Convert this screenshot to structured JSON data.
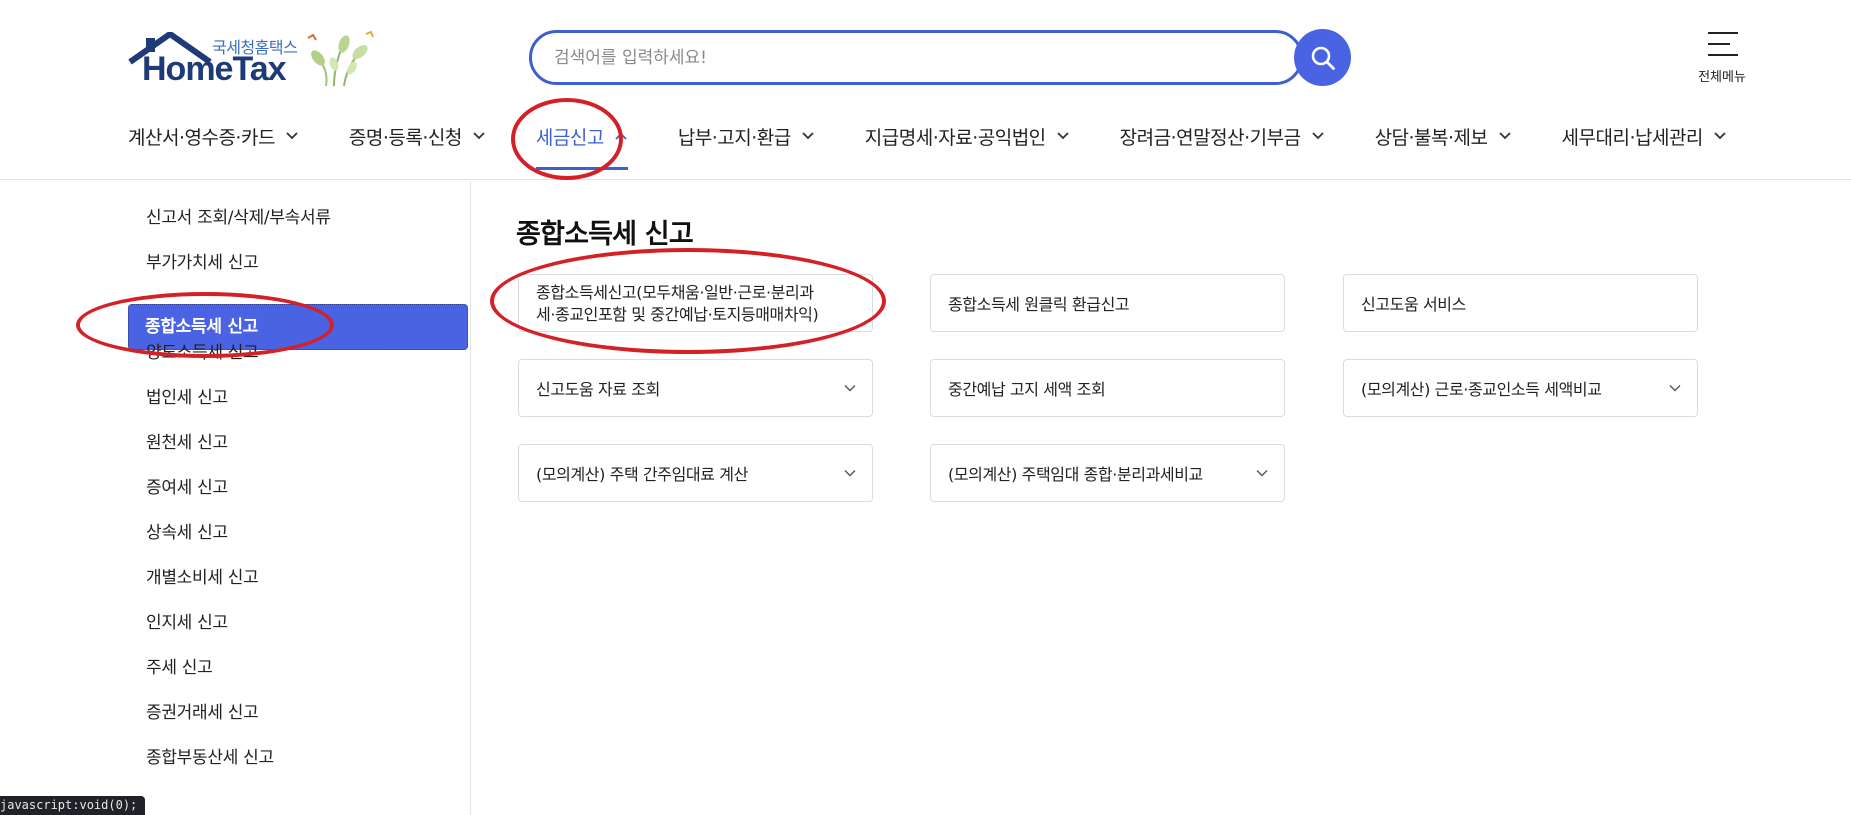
{
  "brand": {
    "sub_label": "국세청홈택스",
    "name": "HomeTax"
  },
  "search": {
    "placeholder": "검색어를 입력하세요!"
  },
  "all_menu": {
    "label": "전체메뉴"
  },
  "gnb": {
    "items": [
      {
        "label": "계산서·영수증·카드",
        "expanded": false
      },
      {
        "label": "증명·등록·신청",
        "expanded": false
      },
      {
        "label": "세금신고",
        "expanded": true
      },
      {
        "label": "납부·고지·환급",
        "expanded": false
      },
      {
        "label": "지급명세·자료·공익법인",
        "expanded": false
      },
      {
        "label": "장려금·연말정산·기부금",
        "expanded": false
      },
      {
        "label": "상담·불복·제보",
        "expanded": false
      },
      {
        "label": "세무대리·납세관리",
        "expanded": false
      }
    ]
  },
  "lnb": {
    "items": [
      {
        "label": "신고서 조회/삭제/부속서류"
      },
      {
        "label": "부가가치세 신고"
      },
      {
        "label": "종합소득세 신고",
        "active": true
      },
      {
        "label": "양도소득세 신고"
      },
      {
        "label": "법인세 신고"
      },
      {
        "label": "원천세 신고"
      },
      {
        "label": "증여세 신고"
      },
      {
        "label": "상속세 신고"
      },
      {
        "label": "개별소비세 신고"
      },
      {
        "label": "인지세 신고"
      },
      {
        "label": "주세 신고"
      },
      {
        "label": "증권거래세 신고"
      },
      {
        "label": "종합부동산세 신고"
      }
    ]
  },
  "main": {
    "title": "종합소득세 신고",
    "cards": [
      {
        "label_line1": "종합소득세신고(모두채움·일반·근로·분리과",
        "label_line2": "세·종교인포함 및 중간예납·토지등매매차익)",
        "has_dropdown": false
      },
      {
        "label": "종합소득세 원클릭 환급신고",
        "has_dropdown": false
      },
      {
        "label": "신고도움 서비스",
        "has_dropdown": false
      },
      {
        "label": "신고도움 자료 조회",
        "has_dropdown": true
      },
      {
        "label": "중간예납 고지 세액 조회",
        "has_dropdown": false
      },
      {
        "label": "(모의계산) 근로·종교인소득 세액비교",
        "has_dropdown": true
      },
      {
        "label": "(모의계산) 주택 간주임대료 계산",
        "has_dropdown": true
      },
      {
        "label": "(모의계산) 주택임대 종합·분리과세비교",
        "has_dropdown": true
      }
    ]
  },
  "status_bar": {
    "text": "javascript:void(0);"
  },
  "colors": {
    "accent": "#4a63e3",
    "brand_navy": "#1e3a78",
    "annotation_red": "#d42128"
  }
}
